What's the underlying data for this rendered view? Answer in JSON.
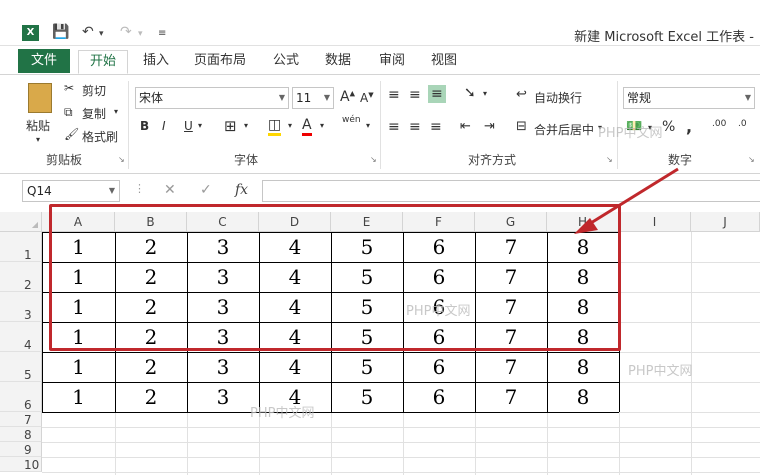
{
  "window": {
    "title": "新建 Microsoft Excel 工作表 -",
    "app_icon": "X"
  },
  "tabs": [
    "文件",
    "开始",
    "插入",
    "页面布局",
    "公式",
    "数据",
    "审阅",
    "视图"
  ],
  "ribbon": {
    "clipboard": {
      "paste": "粘贴",
      "cut": "剪切",
      "copy": "复制",
      "format_painter": "格式刷",
      "label": "剪贴板"
    },
    "font": {
      "font_name": "宋体",
      "font_size": "11",
      "bold": "B",
      "italic": "I",
      "underline": "U",
      "font_color_letter": "A",
      "phonetic": "wén",
      "label": "字体"
    },
    "alignment": {
      "wrap_text": "自动换行",
      "merge_center": "合并后居中",
      "label": "对齐方式"
    },
    "number": {
      "format": "常规",
      "percent": "%",
      "comma": ",",
      "inc_decimal": ".00",
      "dec_decimal": ".0",
      "label": "数字"
    }
  },
  "formula_bar": {
    "name_box": "Q14",
    "fx": "fx",
    "value": ""
  },
  "sheet": {
    "columns": [
      "A",
      "B",
      "C",
      "D",
      "E",
      "F",
      "G",
      "H",
      "I",
      "J"
    ],
    "row_numbers": [
      "1",
      "2",
      "3",
      "4",
      "5",
      "6",
      "7",
      "8",
      "9",
      "10"
    ],
    "rows": [
      [
        "1",
        "2",
        "3",
        "4",
        "5",
        "6",
        "7",
        "8"
      ],
      [
        "1",
        "2",
        "3",
        "4",
        "5",
        "6",
        "7",
        "8"
      ],
      [
        "1",
        "2",
        "3",
        "4",
        "5",
        "6",
        "7",
        "8"
      ],
      [
        "1",
        "2",
        "3",
        "4",
        "5",
        "6",
        "7",
        "8"
      ],
      [
        "1",
        "2",
        "3",
        "4",
        "5",
        "6",
        "7",
        "8"
      ],
      [
        "1",
        "2",
        "3",
        "4",
        "5",
        "6",
        "7",
        "8"
      ]
    ]
  },
  "annotation": {
    "highlight_color": "#c0282c"
  },
  "watermark": "PHP中文网",
  "colors": {
    "excel_green": "#217346"
  }
}
